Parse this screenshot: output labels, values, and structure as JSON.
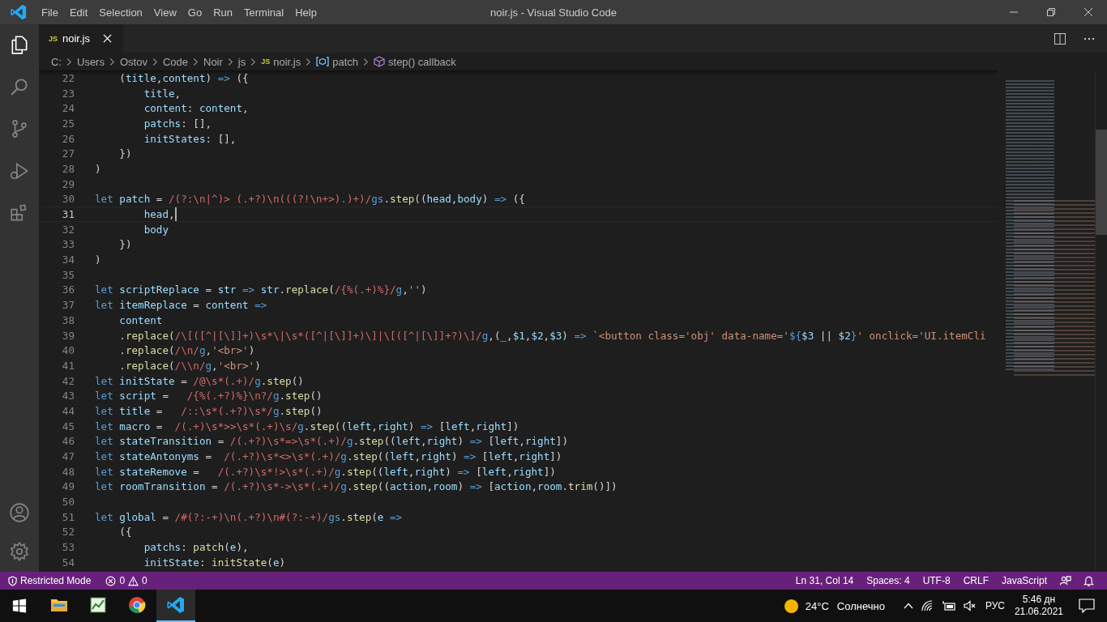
{
  "window": {
    "title": "noir.js - Visual Studio Code"
  },
  "menu": [
    "File",
    "Edit",
    "Selection",
    "View",
    "Go",
    "Run",
    "Terminal",
    "Help"
  ],
  "tabs": [
    {
      "badge": "JS",
      "label": "noir.js",
      "selected": true
    }
  ],
  "breadcrumb": [
    {
      "kind": "folder",
      "label": "C:"
    },
    {
      "kind": "folder",
      "label": "Users"
    },
    {
      "kind": "folder",
      "label": "Ostov"
    },
    {
      "kind": "folder",
      "label": "Code"
    },
    {
      "kind": "folder",
      "label": "Noir"
    },
    {
      "kind": "folder",
      "label": "js"
    },
    {
      "kind": "file",
      "badge": "JS",
      "label": "noir.js"
    },
    {
      "kind": "variable",
      "label": "patch"
    },
    {
      "kind": "method",
      "label": "step() callback"
    }
  ],
  "editor": {
    "lines": [
      {
        "number": "22",
        "current": false,
        "tokens": [
          {
            "kind": "plain",
            "text": "    ("
          },
          {
            "kind": "variable",
            "text": "title"
          },
          {
            "kind": "plain",
            "text": ","
          },
          {
            "kind": "variable",
            "text": "content"
          },
          {
            "kind": "plain",
            "text": ") "
          },
          {
            "kind": "keyword",
            "text": "=>"
          },
          {
            "kind": "plain",
            "text": " ({"
          }
        ]
      },
      {
        "number": "23",
        "current": false,
        "tokens": [
          {
            "kind": "variable",
            "text": "        title"
          },
          {
            "kind": "plain",
            "text": ","
          }
        ]
      },
      {
        "number": "24",
        "current": false,
        "tokens": [
          {
            "kind": "variable",
            "text": "        content"
          },
          {
            "kind": "plain",
            "text": ": "
          },
          {
            "kind": "variable",
            "text": "content"
          },
          {
            "kind": "plain",
            "text": ","
          }
        ]
      },
      {
        "number": "25",
        "current": false,
        "tokens": [
          {
            "kind": "variable",
            "text": "        patchs"
          },
          {
            "kind": "plain",
            "text": ": [],"
          }
        ]
      },
      {
        "number": "26",
        "current": false,
        "tokens": [
          {
            "kind": "variable",
            "text": "        initStates"
          },
          {
            "kind": "plain",
            "text": ": [],"
          }
        ]
      },
      {
        "number": "27",
        "current": false,
        "tokens": [
          {
            "kind": "plain",
            "text": "    })"
          }
        ]
      },
      {
        "number": "28",
        "current": false,
        "tokens": [
          {
            "kind": "plain",
            "text": ")"
          }
        ]
      },
      {
        "number": "29",
        "current": false
      },
      {
        "number": "30",
        "current": false,
        "tokens": [
          {
            "kind": "keyword",
            "text": "let "
          },
          {
            "kind": "variable",
            "text": "patch"
          },
          {
            "kind": "plain",
            "text": " = "
          },
          {
            "kind": "regex",
            "text": "/(?:\\n|^)> (.+?)\\n(((?!\\n+>).)+)/"
          },
          {
            "kind": "keyword",
            "text": "gs"
          },
          {
            "kind": "plain",
            "text": "."
          },
          {
            "kind": "function",
            "text": "step"
          },
          {
            "kind": "plain",
            "text": "(("
          },
          {
            "kind": "variable",
            "text": "head"
          },
          {
            "kind": "plain",
            "text": ","
          },
          {
            "kind": "variable",
            "text": "body"
          },
          {
            "kind": "plain",
            "text": ") "
          },
          {
            "kind": "keyword",
            "text": "=>"
          },
          {
            "kind": "plain",
            "text": " ({"
          }
        ]
      },
      {
        "number": "31",
        "current": true,
        "tokens": [
          {
            "kind": "variable",
            "text": "        head"
          },
          {
            "kind": "plain",
            "text": ","
          }
        ]
      },
      {
        "number": "32",
        "current": false,
        "tokens": [
          {
            "kind": "variable",
            "text": "        body"
          }
        ]
      },
      {
        "number": "33",
        "current": false,
        "tokens": [
          {
            "kind": "plain",
            "text": "    })"
          }
        ]
      },
      {
        "number": "34",
        "current": false,
        "tokens": [
          {
            "kind": "plain",
            "text": ")"
          }
        ]
      },
      {
        "number": "35",
        "current": false
      },
      {
        "number": "36",
        "current": false,
        "tokens": [
          {
            "kind": "keyword",
            "text": "let "
          },
          {
            "kind": "variable",
            "text": "scriptReplace"
          },
          {
            "kind": "plain",
            "text": " = "
          },
          {
            "kind": "variable",
            "text": "str"
          },
          {
            "kind": "keyword",
            "text": " => "
          },
          {
            "kind": "variable",
            "text": "str"
          },
          {
            "kind": "plain",
            "text": "."
          },
          {
            "kind": "function",
            "text": "replace"
          },
          {
            "kind": "plain",
            "text": "("
          },
          {
            "kind": "regex",
            "text": "/{%(.+)%}/"
          },
          {
            "kind": "keyword",
            "text": "g"
          },
          {
            "kind": "plain",
            "text": ","
          },
          {
            "kind": "string",
            "text": "''"
          },
          {
            "kind": "plain",
            "text": ")"
          }
        ]
      },
      {
        "number": "37",
        "current": false,
        "tokens": [
          {
            "kind": "keyword",
            "text": "let "
          },
          {
            "kind": "variable",
            "text": "itemReplace"
          },
          {
            "kind": "plain",
            "text": " = "
          },
          {
            "kind": "variable",
            "text": "content"
          },
          {
            "kind": "keyword",
            "text": " =>"
          }
        ]
      },
      {
        "number": "38",
        "current": false,
        "tokens": [
          {
            "kind": "variable",
            "text": "    content"
          }
        ]
      },
      {
        "number": "39",
        "current": false,
        "tokens": [
          {
            "kind": "plain",
            "text": "    ."
          },
          {
            "kind": "function",
            "text": "replace"
          },
          {
            "kind": "plain",
            "text": "("
          },
          {
            "kind": "regex",
            "text": "/\\[([^|[\\]]+)\\s*\\|\\s*([^|[\\]]+)\\]|\\[([^|[\\]]+?)\\]/"
          },
          {
            "kind": "keyword",
            "text": "g"
          },
          {
            "kind": "plain",
            "text": ",("
          },
          {
            "kind": "variable",
            "text": "_"
          },
          {
            "kind": "plain",
            "text": ","
          },
          {
            "kind": "variable",
            "text": "$1"
          },
          {
            "kind": "plain",
            "text": ","
          },
          {
            "kind": "variable",
            "text": "$2"
          },
          {
            "kind": "plain",
            "text": ","
          },
          {
            "kind": "variable",
            "text": "$3"
          },
          {
            "kind": "plain",
            "text": ") "
          },
          {
            "kind": "keyword",
            "text": "=>"
          },
          {
            "kind": "string",
            "text": " `<button class='obj' data-name='"
          },
          {
            "kind": "keyword",
            "text": "${"
          },
          {
            "kind": "variable",
            "text": "$3"
          },
          {
            "kind": "plain",
            "text": " || "
          },
          {
            "kind": "variable",
            "text": "$2"
          },
          {
            "kind": "keyword",
            "text": "}"
          },
          {
            "kind": "string",
            "text": "' onclick='UI.itemCli"
          }
        ]
      },
      {
        "number": "40",
        "current": false,
        "tokens": [
          {
            "kind": "plain",
            "text": "    ."
          },
          {
            "kind": "function",
            "text": "replace"
          },
          {
            "kind": "plain",
            "text": "("
          },
          {
            "kind": "regex",
            "text": "/\\n/"
          },
          {
            "kind": "keyword",
            "text": "g"
          },
          {
            "kind": "plain",
            "text": ","
          },
          {
            "kind": "string",
            "text": "'<br>'"
          },
          {
            "kind": "plain",
            "text": ")"
          }
        ]
      },
      {
        "number": "41",
        "current": false,
        "tokens": [
          {
            "kind": "plain",
            "text": "    ."
          },
          {
            "kind": "function",
            "text": "replace"
          },
          {
            "kind": "plain",
            "text": "("
          },
          {
            "kind": "regex",
            "text": "/\\\\n/"
          },
          {
            "kind": "keyword",
            "text": "g"
          },
          {
            "kind": "plain",
            "text": ","
          },
          {
            "kind": "string",
            "text": "'<br>'"
          },
          {
            "kind": "plain",
            "text": ")"
          }
        ]
      },
      {
        "number": "42",
        "current": false,
        "tokens": [
          {
            "kind": "keyword",
            "text": "let "
          },
          {
            "kind": "variable",
            "text": "initState"
          },
          {
            "kind": "plain",
            "text": " = "
          },
          {
            "kind": "regex",
            "text": "/@\\s*(.+)/"
          },
          {
            "kind": "keyword",
            "text": "g"
          },
          {
            "kind": "plain",
            "text": "."
          },
          {
            "kind": "function",
            "text": "step"
          },
          {
            "kind": "plain",
            "text": "()"
          }
        ]
      },
      {
        "number": "43",
        "current": false,
        "tokens": [
          {
            "kind": "keyword",
            "text": "let "
          },
          {
            "kind": "variable",
            "text": "script"
          },
          {
            "kind": "plain",
            "text": " =   "
          },
          {
            "kind": "regex",
            "text": "/{%(.+?)%}\\n?/"
          },
          {
            "kind": "keyword",
            "text": "g"
          },
          {
            "kind": "plain",
            "text": "."
          },
          {
            "kind": "function",
            "text": "step"
          },
          {
            "kind": "plain",
            "text": "()"
          }
        ]
      },
      {
        "number": "44",
        "current": false,
        "tokens": [
          {
            "kind": "keyword",
            "text": "let "
          },
          {
            "kind": "variable",
            "text": "title"
          },
          {
            "kind": "plain",
            "text": " =   "
          },
          {
            "kind": "regex",
            "text": "/::\\s*(.+?)\\s*/"
          },
          {
            "kind": "keyword",
            "text": "g"
          },
          {
            "kind": "plain",
            "text": "."
          },
          {
            "kind": "function",
            "text": "step"
          },
          {
            "kind": "plain",
            "text": "()"
          }
        ]
      },
      {
        "number": "45",
        "current": false,
        "tokens": [
          {
            "kind": "keyword",
            "text": "let "
          },
          {
            "kind": "variable",
            "text": "macro"
          },
          {
            "kind": "plain",
            "text": " =  "
          },
          {
            "kind": "regex",
            "text": "/(.+)\\s*>>\\s*(.+)\\s/"
          },
          {
            "kind": "keyword",
            "text": "g"
          },
          {
            "kind": "plain",
            "text": "."
          },
          {
            "kind": "function",
            "text": "step"
          },
          {
            "kind": "plain",
            "text": "(("
          },
          {
            "kind": "variable",
            "text": "left"
          },
          {
            "kind": "plain",
            "text": ","
          },
          {
            "kind": "variable",
            "text": "right"
          },
          {
            "kind": "plain",
            "text": ") "
          },
          {
            "kind": "keyword",
            "text": "=>"
          },
          {
            "kind": "plain",
            "text": " ["
          },
          {
            "kind": "variable",
            "text": "left"
          },
          {
            "kind": "plain",
            "text": ","
          },
          {
            "kind": "variable",
            "text": "right"
          },
          {
            "kind": "plain",
            "text": "])"
          }
        ]
      },
      {
        "number": "46",
        "current": false,
        "tokens": [
          {
            "kind": "keyword",
            "text": "let "
          },
          {
            "kind": "variable",
            "text": "stateTransition"
          },
          {
            "kind": "plain",
            "text": " = "
          },
          {
            "kind": "regex",
            "text": "/(.+?)\\s*=>\\s*(.+)/"
          },
          {
            "kind": "keyword",
            "text": "g"
          },
          {
            "kind": "plain",
            "text": "."
          },
          {
            "kind": "function",
            "text": "step"
          },
          {
            "kind": "plain",
            "text": "(("
          },
          {
            "kind": "variable",
            "text": "left"
          },
          {
            "kind": "plain",
            "text": ","
          },
          {
            "kind": "variable",
            "text": "right"
          },
          {
            "kind": "plain",
            "text": ") "
          },
          {
            "kind": "keyword",
            "text": "=>"
          },
          {
            "kind": "plain",
            "text": " ["
          },
          {
            "kind": "variable",
            "text": "left"
          },
          {
            "kind": "plain",
            "text": ","
          },
          {
            "kind": "variable",
            "text": "right"
          },
          {
            "kind": "plain",
            "text": "])"
          }
        ]
      },
      {
        "number": "47",
        "current": false,
        "tokens": [
          {
            "kind": "keyword",
            "text": "let "
          },
          {
            "kind": "variable",
            "text": "stateAntonyms"
          },
          {
            "kind": "plain",
            "text": " =  "
          },
          {
            "kind": "regex",
            "text": "/(.+?)\\s*<>\\s*(.+)/"
          },
          {
            "kind": "keyword",
            "text": "g"
          },
          {
            "kind": "plain",
            "text": "."
          },
          {
            "kind": "function",
            "text": "step"
          },
          {
            "kind": "plain",
            "text": "(("
          },
          {
            "kind": "variable",
            "text": "left"
          },
          {
            "kind": "plain",
            "text": ","
          },
          {
            "kind": "variable",
            "text": "right"
          },
          {
            "kind": "plain",
            "text": ") "
          },
          {
            "kind": "keyword",
            "text": "=>"
          },
          {
            "kind": "plain",
            "text": " ["
          },
          {
            "kind": "variable",
            "text": "left"
          },
          {
            "kind": "plain",
            "text": ","
          },
          {
            "kind": "variable",
            "text": "right"
          },
          {
            "kind": "plain",
            "text": "])"
          }
        ]
      },
      {
        "number": "48",
        "current": false,
        "tokens": [
          {
            "kind": "keyword",
            "text": "let "
          },
          {
            "kind": "variable",
            "text": "stateRemove"
          },
          {
            "kind": "plain",
            "text": " =   "
          },
          {
            "kind": "regex",
            "text": "/(.+?)\\s*!>\\s*(.+)/"
          },
          {
            "kind": "keyword",
            "text": "g"
          },
          {
            "kind": "plain",
            "text": "."
          },
          {
            "kind": "function",
            "text": "step"
          },
          {
            "kind": "plain",
            "text": "(("
          },
          {
            "kind": "variable",
            "text": "left"
          },
          {
            "kind": "plain",
            "text": ","
          },
          {
            "kind": "variable",
            "text": "right"
          },
          {
            "kind": "plain",
            "text": ") "
          },
          {
            "kind": "keyword",
            "text": "=>"
          },
          {
            "kind": "plain",
            "text": " ["
          },
          {
            "kind": "variable",
            "text": "left"
          },
          {
            "kind": "plain",
            "text": ","
          },
          {
            "kind": "variable",
            "text": "right"
          },
          {
            "kind": "plain",
            "text": "])"
          }
        ]
      },
      {
        "number": "49",
        "current": false,
        "tokens": [
          {
            "kind": "keyword",
            "text": "let "
          },
          {
            "kind": "variable",
            "text": "roomTransition"
          },
          {
            "kind": "plain",
            "text": " = "
          },
          {
            "kind": "regex",
            "text": "/(.+?)\\s*->\\s*(.+)/"
          },
          {
            "kind": "keyword",
            "text": "g"
          },
          {
            "kind": "plain",
            "text": "."
          },
          {
            "kind": "function",
            "text": "step"
          },
          {
            "kind": "plain",
            "text": "(("
          },
          {
            "kind": "variable",
            "text": "action"
          },
          {
            "kind": "plain",
            "text": ","
          },
          {
            "kind": "variable",
            "text": "room"
          },
          {
            "kind": "plain",
            "text": ") "
          },
          {
            "kind": "keyword",
            "text": "=>"
          },
          {
            "kind": "plain",
            "text": " ["
          },
          {
            "kind": "variable",
            "text": "action"
          },
          {
            "kind": "plain",
            "text": ","
          },
          {
            "kind": "variable",
            "text": "room"
          },
          {
            "kind": "plain",
            "text": "."
          },
          {
            "kind": "function",
            "text": "trim"
          },
          {
            "kind": "plain",
            "text": "()])"
          }
        ]
      },
      {
        "number": "50",
        "current": false
      },
      {
        "number": "51",
        "current": false,
        "tokens": [
          {
            "kind": "keyword",
            "text": "let "
          },
          {
            "kind": "variable",
            "text": "global"
          },
          {
            "kind": "plain",
            "text": " = "
          },
          {
            "kind": "regex",
            "text": "/#(?:-+)\\n(.+?)\\n#(?:-+)/"
          },
          {
            "kind": "keyword",
            "text": "gs"
          },
          {
            "kind": "plain",
            "text": "."
          },
          {
            "kind": "function",
            "text": "step"
          },
          {
            "kind": "plain",
            "text": "("
          },
          {
            "kind": "variable",
            "text": "e"
          },
          {
            "kind": "keyword",
            "text": " =>"
          }
        ]
      },
      {
        "number": "52",
        "current": false,
        "tokens": [
          {
            "kind": "plain",
            "text": "    ({"
          }
        ]
      },
      {
        "number": "53",
        "current": false,
        "tokens": [
          {
            "kind": "variable",
            "text": "        patchs"
          },
          {
            "kind": "plain",
            "text": ": "
          },
          {
            "kind": "function",
            "text": "patch"
          },
          {
            "kind": "plain",
            "text": "("
          },
          {
            "kind": "variable",
            "text": "e"
          },
          {
            "kind": "plain",
            "text": "),"
          }
        ]
      },
      {
        "number": "54",
        "current": false,
        "tokens": [
          {
            "kind": "variable",
            "text": "        initState"
          },
          {
            "kind": "plain",
            "text": ": "
          },
          {
            "kind": "function",
            "text": "initState"
          },
          {
            "kind": "plain",
            "text": "("
          },
          {
            "kind": "variable",
            "text": "e"
          },
          {
            "kind": "plain",
            "text": ")"
          }
        ]
      }
    ]
  },
  "status_bar": {
    "left": [
      {
        "kind": "restricted",
        "text": "Restricted Mode"
      },
      {
        "kind": "problems",
        "errors": "0",
        "warnings": "0"
      }
    ],
    "right": [
      {
        "kind": "text",
        "text": "Ln 31, Col 14"
      },
      {
        "kind": "text",
        "text": "Spaces: 4"
      },
      {
        "kind": "text",
        "text": "UTF-8"
      },
      {
        "kind": "text",
        "text": "CRLF"
      },
      {
        "kind": "text",
        "text": "JavaScript"
      },
      {
        "kind": "feedback"
      },
      {
        "kind": "bell"
      }
    ]
  },
  "taskbar": {
    "apps": [
      {
        "kind": "explorer",
        "selected": false
      },
      {
        "kind": "chart",
        "selected": false
      },
      {
        "kind": "browser",
        "selected": false
      },
      {
        "kind": "editor",
        "selected": true
      }
    ],
    "weather": {
      "temperature": "24°C",
      "condition": "Солнечно"
    },
    "language": "РУС",
    "time": "5:46 дн",
    "date": "21.06.2021"
  }
}
